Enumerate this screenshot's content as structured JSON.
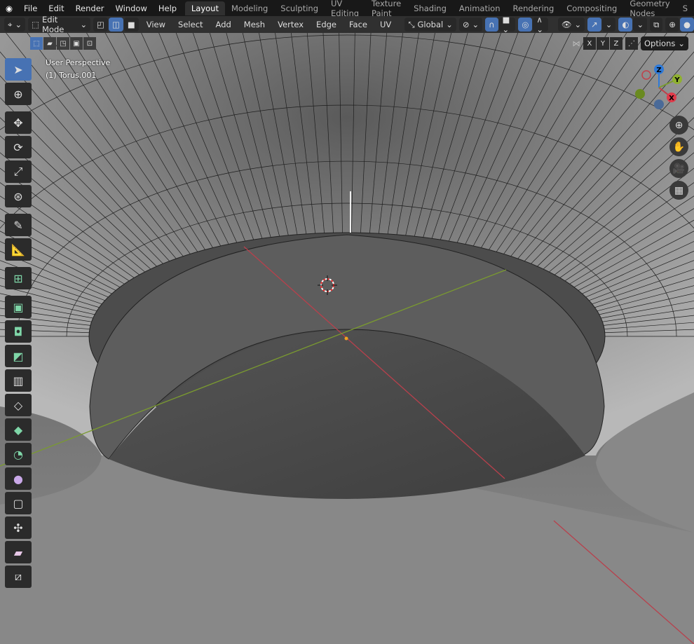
{
  "topbar": {
    "menus": [
      "File",
      "Edit",
      "Render",
      "Window",
      "Help"
    ],
    "workspaces": [
      "Layout",
      "Modeling",
      "Sculpting",
      "UV Editing",
      "Texture Paint",
      "Shading",
      "Animation",
      "Rendering",
      "Compositing",
      "Geometry Nodes",
      "S"
    ],
    "active_workspace": "Layout"
  },
  "header": {
    "mode": "Edit Mode",
    "menus": [
      "View",
      "Select",
      "Add",
      "Mesh",
      "Vertex",
      "Edge",
      "Face",
      "UV"
    ],
    "orientation": "Global",
    "select_mode_active": "edge"
  },
  "viewport": {
    "perspective": "User Perspective",
    "object": "(1) Torus.001",
    "axis_x": "X",
    "axis_y": "Y",
    "axis_z": "Z",
    "options": "Options",
    "mirror": {
      "x": "X",
      "y": "Y",
      "z": "Z"
    }
  },
  "colors": {
    "accent": "#4772b3",
    "x_axis": "#c0404a",
    "y_axis": "#7a9a30",
    "z_axis": "#2f7ad8"
  },
  "toolbar": {
    "tools": [
      "select-box",
      "cursor",
      "move",
      "rotate",
      "scale",
      "transform",
      "annotate",
      "measure",
      "add-cube",
      "extrude",
      "inset",
      "bevel",
      "loop-cut",
      "knife",
      "poly-build",
      "spin",
      "smooth",
      "shrink-fatten",
      "shear",
      "rip"
    ],
    "active": "select-box"
  }
}
